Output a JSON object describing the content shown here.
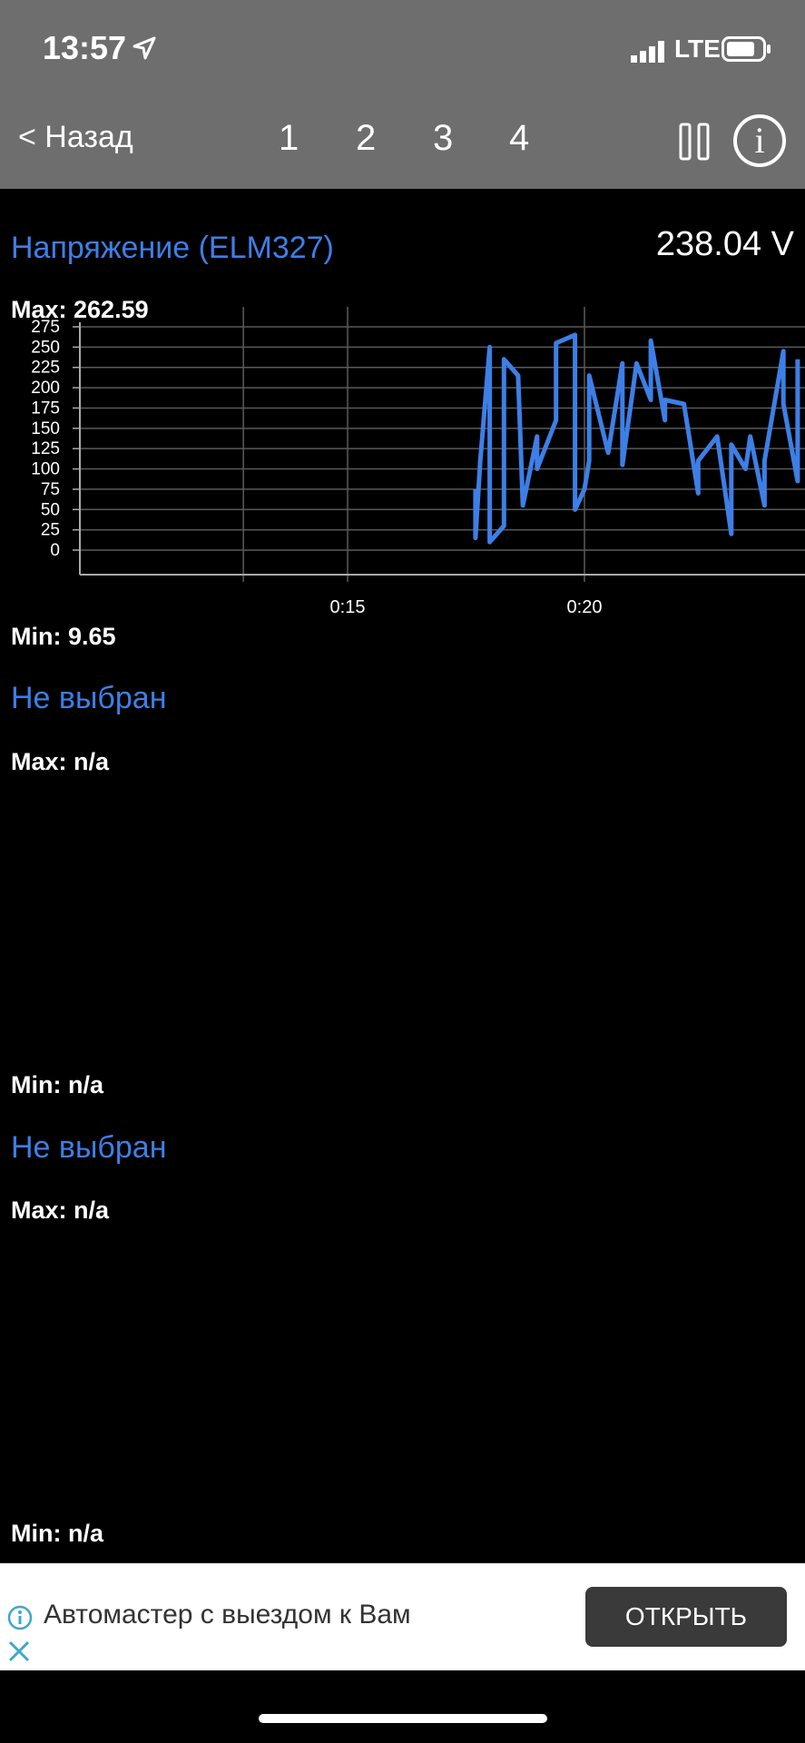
{
  "status_bar": {
    "time": "13:57",
    "network": "LTE"
  },
  "nav": {
    "back_label": "< Назад",
    "tabs": [
      "1",
      "2",
      "3",
      "4"
    ]
  },
  "sensors": [
    {
      "title": "Напряжение (ELM327)",
      "value": "238.04  V",
      "max": "Max: 262.59",
      "min": "Min: 9.65"
    },
    {
      "title": "Не выбран",
      "max": "Max: n/a",
      "min": "Min: n/a"
    },
    {
      "title": "Не выбран",
      "max": "Max: n/a",
      "min": "Min: n/a"
    }
  ],
  "chart_data": {
    "type": "line",
    "y_ticks": [
      "0",
      "25",
      "50",
      "75",
      "100",
      "125",
      "150",
      "175",
      "200",
      "225",
      "250",
      "275"
    ],
    "x_ticks": [
      "0:15",
      "0:20"
    ],
    "ylim": [
      0,
      275
    ],
    "grid": true,
    "line_color": "#3d7fe6",
    "series": [
      {
        "values": [
          [
            17.7,
            75
          ],
          [
            17.7,
            15
          ],
          [
            17.8,
            110
          ],
          [
            18.0,
            250
          ],
          [
            18.0,
            10
          ],
          [
            18.3,
            30
          ],
          [
            18.3,
            235
          ],
          [
            18.6,
            215
          ],
          [
            18.7,
            55
          ],
          [
            19.0,
            140
          ],
          [
            19.0,
            100
          ],
          [
            19.4,
            160
          ],
          [
            19.4,
            255
          ],
          [
            19.8,
            265
          ],
          [
            19.8,
            50
          ],
          [
            20.0,
            75
          ],
          [
            20.1,
            110
          ],
          [
            20.1,
            215
          ],
          [
            20.5,
            120
          ],
          [
            20.8,
            230
          ],
          [
            20.8,
            105
          ],
          [
            21.1,
            230
          ],
          [
            21.4,
            185
          ],
          [
            21.4,
            258
          ],
          [
            21.7,
            160
          ],
          [
            21.7,
            185
          ],
          [
            22.1,
            180
          ],
          [
            22.4,
            70
          ],
          [
            22.4,
            110
          ],
          [
            22.8,
            140
          ],
          [
            23.1,
            20
          ],
          [
            23.1,
            130
          ],
          [
            23.4,
            100
          ],
          [
            23.5,
            140
          ],
          [
            23.8,
            55
          ],
          [
            23.8,
            110
          ],
          [
            24.2,
            245
          ],
          [
            24.2,
            180
          ],
          [
            24.5,
            85
          ],
          [
            24.5,
            235
          ]
        ]
      }
    ]
  },
  "ad": {
    "text": "Автомастер с выездом к Вам",
    "button_label": "ОТКРЫТЬ"
  },
  "colors": {
    "accent": "#3d7fe6",
    "topbar": "#6e6e6e",
    "background": "#000000"
  }
}
